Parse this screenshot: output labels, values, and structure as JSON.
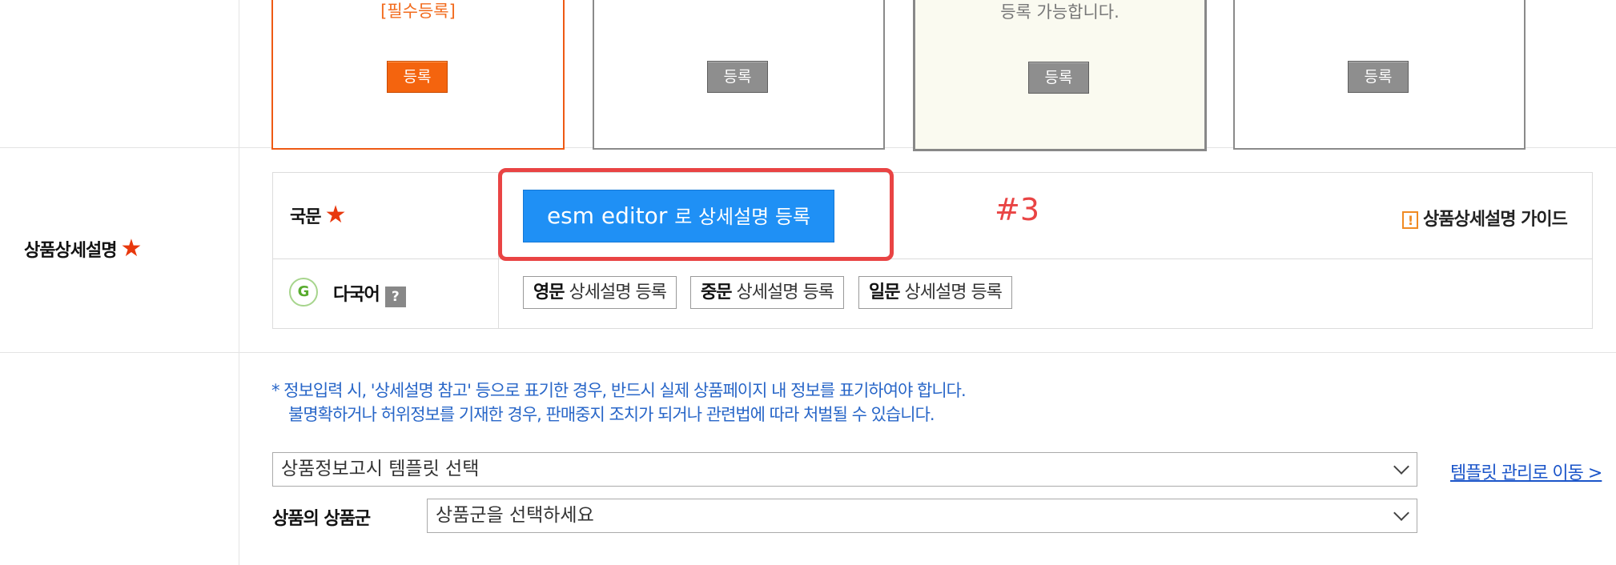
{
  "image_boxes": [
    {
      "text": "[필수등록]",
      "button": "등록"
    },
    {
      "text": "",
      "button": "등록"
    },
    {
      "text": "등록 가능합니다.",
      "button": "등록"
    },
    {
      "text": "",
      "button": "등록"
    }
  ],
  "detail": {
    "section_label": "상품상세설명",
    "row_korean_label": "국문",
    "esm_button_main": "esm editor",
    "esm_button_rest": "로 상세설명 등록",
    "annotation": "#3",
    "guide_icon": "!",
    "guide_label": "상품상세설명 가이드",
    "multilang_icon": "G",
    "multilang_label": "다국어",
    "help_icon": "?",
    "lang_buttons": [
      {
        "lang": "영문",
        "label": "상세설명 등록"
      },
      {
        "lang": "중문",
        "label": "상세설명 등록"
      },
      {
        "lang": "일문",
        "label": "상세설명 등록"
      }
    ]
  },
  "notice": {
    "line1": "*  정보입력 시, '상세설명 참고' 등으로 표기한 경우, 반드시 실제 상품페이지 내 정보를 표기하여야 합니다.",
    "line2": "불명확하거나 허위정보를 기재한 경우, 판매중지 조치가 되거나 관련법에 따라 처벌될 수 있습니다."
  },
  "template": {
    "select_value": "상품정보고시 템플릿 선택",
    "link": "템플릿 관리로 이동 >"
  },
  "product_group": {
    "label": "상품의 상품군",
    "select_value": "상품군을 선택하세요"
  },
  "colors": {
    "accent_blue": "#1f90f5",
    "required_orange": "#f4640e",
    "highlight_red": "#e94444",
    "notice_blue": "#2866c8"
  }
}
